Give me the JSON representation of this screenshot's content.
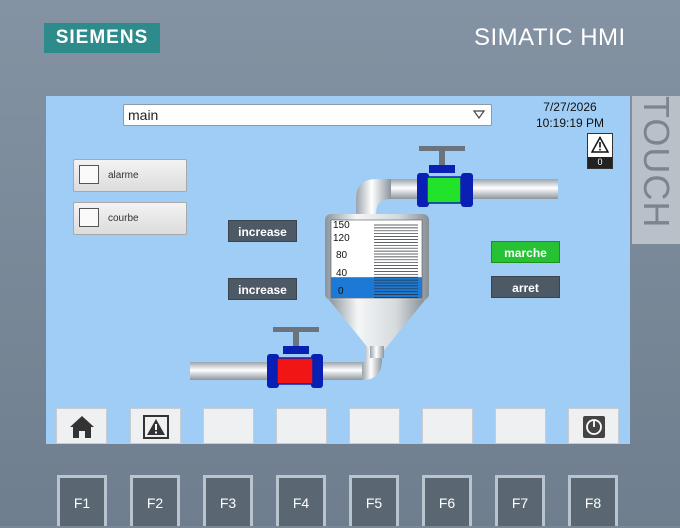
{
  "header": {
    "brand": "SIEMENS",
    "model": "SIMATIC HMI",
    "touch_label": "TOUCH"
  },
  "screen": {
    "selector_value": "main",
    "date": "7/27/2026",
    "time": "10:19:19 PM",
    "alarm_count": "0",
    "screen_buttons": [
      "alarme",
      "courbe"
    ],
    "valve_buttons": [
      "increase",
      "increase"
    ],
    "motor_buttons": {
      "start": "marche",
      "stop": "arret"
    },
    "tank": {
      "ticks": [
        "150",
        "120",
        "80",
        "40",
        "0"
      ],
      "level": 40,
      "max": 150,
      "fill_color": "#1c7ad6"
    },
    "valves": {
      "outlet_color": "#22e22a",
      "inlet_color": "#f21515",
      "body_color": "#0a1fb4"
    },
    "softkeys": [
      {
        "icon": "home-icon"
      },
      {
        "icon": "alarm-warning-icon"
      },
      {
        "icon": ""
      },
      {
        "icon": ""
      },
      {
        "icon": ""
      },
      {
        "icon": ""
      },
      {
        "icon": ""
      },
      {
        "icon": "power-icon"
      }
    ]
  },
  "function_keys": [
    "F1",
    "F2",
    "F3",
    "F4",
    "F5",
    "F6",
    "F7",
    "F8"
  ],
  "colors": {
    "screen_bg": "#9fcdf5",
    "bezel": "#7a8796",
    "brand_bg": "#2e8b8b"
  }
}
